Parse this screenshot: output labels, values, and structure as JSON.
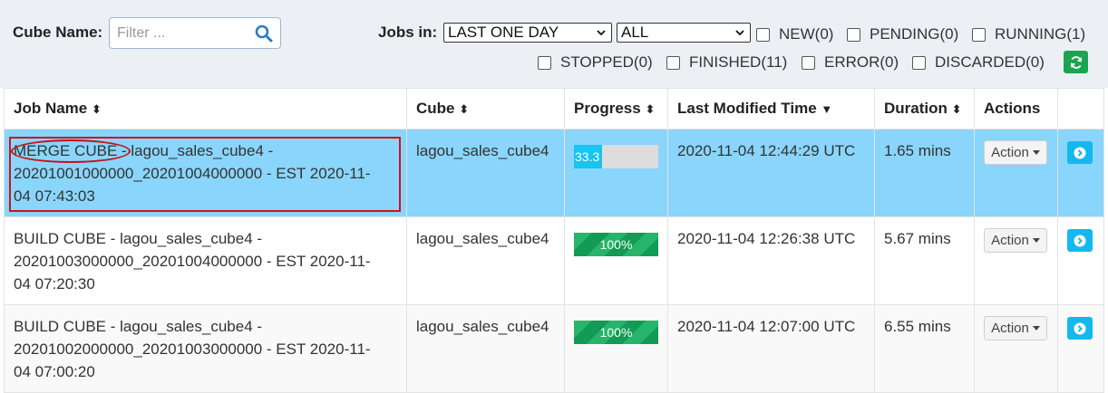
{
  "filters": {
    "cube_name_label": "Cube Name:",
    "filter_placeholder": "Filter ...",
    "jobs_in_label": "Jobs in:",
    "time_range_selected": "LAST ONE DAY",
    "job_type_selected": "ALL",
    "status_checkboxes": [
      {
        "label": "NEW(0)",
        "checked": false
      },
      {
        "label": "PENDING(0)",
        "checked": false
      },
      {
        "label": "RUNNING(1)",
        "checked": false
      },
      {
        "label": "STOPPED(0)",
        "checked": false
      },
      {
        "label": "FINISHED(11)",
        "checked": false
      },
      {
        "label": "ERROR(0)",
        "checked": false
      },
      {
        "label": "DISCARDED(0)",
        "checked": false
      }
    ],
    "refresh_icon": "refresh-icon"
  },
  "table": {
    "columns": [
      {
        "label": "Job Name",
        "sort": "both"
      },
      {
        "label": "Cube",
        "sort": "both"
      },
      {
        "label": "Progress",
        "sort": "both"
      },
      {
        "label": "Last Modified Time",
        "sort": "desc"
      },
      {
        "label": "Duration",
        "sort": "both"
      },
      {
        "label": "Actions",
        "sort": "none"
      },
      {
        "label": "",
        "sort": "none"
      }
    ],
    "rows": [
      {
        "job_type": "MERGE CUBE",
        "job_rest_line1": " - lagou_sales_cube4 -",
        "job_line2": "20201001000000_20201004000000 - EST 2020-11-",
        "job_line3": "04 07:43:03",
        "cube": "lagou_sales_cube4",
        "progress": 33.3,
        "progress_label": "33.3",
        "last_modified": "2020-11-04 12:44:29 UTC",
        "duration": "1.65 mins",
        "action_label": "Action"
      },
      {
        "job_type": "BUILD CUBE",
        "job_rest_line1": " - lagou_sales_cube4 -",
        "job_line2": "20201003000000_20201004000000 - EST 2020-11-",
        "job_line3": "04 07:20:30",
        "cube": "lagou_sales_cube4",
        "progress": 100,
        "progress_label": "100%",
        "last_modified": "2020-11-04 12:26:38 UTC",
        "duration": "5.67 mins",
        "action_label": "Action"
      },
      {
        "job_type": "BUILD CUBE",
        "job_rest_line1": " - lagou_sales_cube4 -",
        "job_line2": "20201002000000_20201003000000 - EST 2020-11-",
        "job_line3": "04 07:00:20",
        "cube": "lagou_sales_cube4",
        "progress": 100,
        "progress_label": "100%",
        "last_modified": "2020-11-04 12:07:00 UTC",
        "duration": "6.55 mins",
        "action_label": "Action"
      }
    ]
  },
  "colors": {
    "selected_row": "#8ad5fb",
    "progress_running": "#18c4f0",
    "progress_done": "#19a65d",
    "refresh_button": "#1aa64f",
    "annotation": "#d0121b"
  }
}
